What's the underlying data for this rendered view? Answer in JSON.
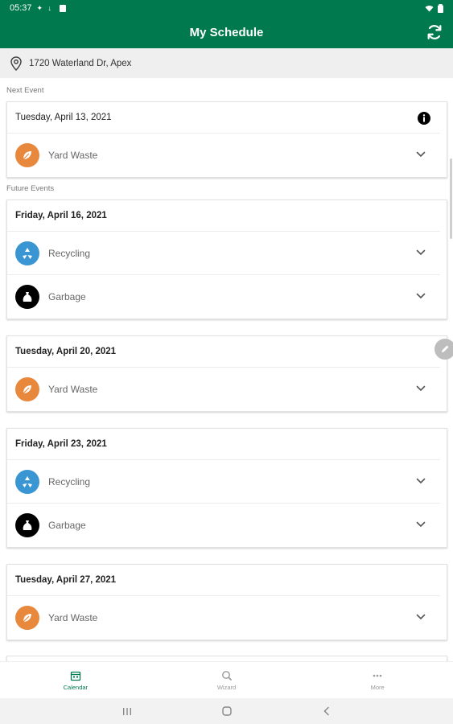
{
  "status_bar": {
    "time": "05:37"
  },
  "app_bar": {
    "title": "My Schedule"
  },
  "address": {
    "text": "1720 Waterland Dr, Apex"
  },
  "sections": {
    "next": "Next Event",
    "future": "Future Events"
  },
  "next_event": {
    "date": "Tuesday, April 13, 2021",
    "items": [
      {
        "label": "Yard Waste",
        "icon": "leaf-icon"
      }
    ]
  },
  "future_events": [
    {
      "date": "Friday, April 16, 2021",
      "items": [
        {
          "label": "Recycling",
          "icon": "recycle-icon"
        },
        {
          "label": "Garbage",
          "icon": "garbage-bag-icon"
        }
      ]
    },
    {
      "date": "Tuesday, April 20, 2021",
      "items": [
        {
          "label": "Yard Waste",
          "icon": "leaf-icon"
        }
      ]
    },
    {
      "date": "Friday, April 23, 2021",
      "items": [
        {
          "label": "Recycling",
          "icon": "recycle-icon"
        },
        {
          "label": "Garbage",
          "icon": "garbage-bag-icon"
        }
      ]
    },
    {
      "date": "Tuesday, April 27, 2021",
      "items": [
        {
          "label": "Yard Waste",
          "icon": "leaf-icon"
        }
      ]
    }
  ],
  "bottom_nav": {
    "calendar": "Calendar",
    "wizard": "Wizard",
    "more": "More"
  },
  "colors": {
    "primary": "#00794f",
    "yard": "#e8883d",
    "recycling": "#3a96d3",
    "garbage": "#000000"
  }
}
